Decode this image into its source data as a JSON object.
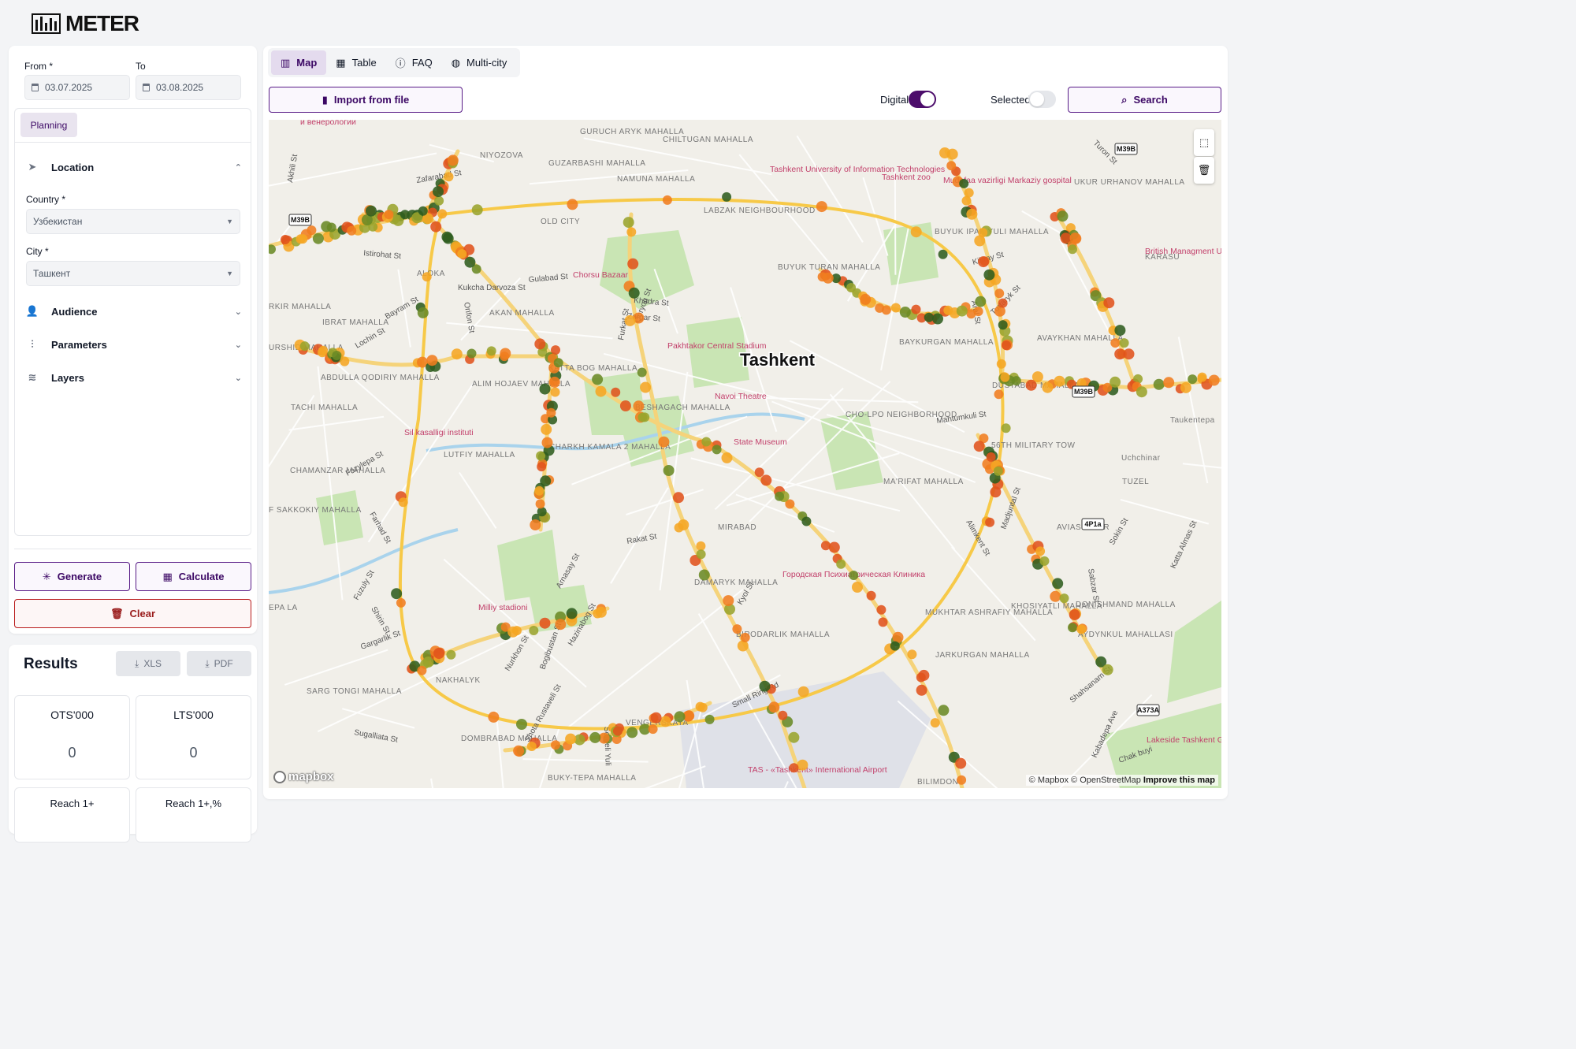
{
  "app": {
    "logo_text": "METER"
  },
  "filters": {
    "from_label": "From *",
    "from_value": "03.07.2025",
    "to_label": "To",
    "to_value": "03.08.2025"
  },
  "planning_tab": "Planning",
  "sections": {
    "location": "Location",
    "country_label": "Country *",
    "country_value": "Узбекистан",
    "city_label": "City *",
    "city_value": "Ташкент",
    "audience": "Audience",
    "parameters": "Parameters",
    "layers": "Layers"
  },
  "actions": {
    "generate": "Generate",
    "calculate": "Calculate",
    "clear": "Clear"
  },
  "results": {
    "title": "Results",
    "xls": "XLS",
    "pdf": "PDF",
    "cards": [
      {
        "label": "OTS'000",
        "value": "0"
      },
      {
        "label": "LTS'000",
        "value": "0"
      },
      {
        "label": "Reach 1+",
        "value": ""
      },
      {
        "label": "Reach 1+,%",
        "value": ""
      }
    ]
  },
  "tabs": [
    {
      "label": "Map",
      "icon": "map-icon",
      "active": true
    },
    {
      "label": "Table",
      "icon": "grid-icon",
      "active": false
    },
    {
      "label": "FAQ",
      "icon": "help-circle-icon",
      "active": false
    },
    {
      "label": "Multi-city",
      "icon": "globe-icon",
      "active": false
    }
  ],
  "toolbar": {
    "import": "Import from file",
    "digital_label": "Digital",
    "digital_on": true,
    "selected_label": "Selected",
    "selected_on": false,
    "search": "Search"
  },
  "map": {
    "city_label": "Tashkent",
    "attribution_mapbox": "© Mapbox",
    "attribution_osm": "© OpenStreetMap",
    "improve": "Improve this map",
    "mapbox_logo": "mapbox",
    "district_labels": [
      "GURUCH ARYK MAHALLA",
      "CHILTUGAN MAHALLA",
      "NIYOZOVA",
      "GUZARBASHI MAHALLA",
      "NAMUNA MAHALLA",
      "OLD CITY",
      "LABZAK NEIGHBOURHOOD",
      "ALOKA",
      "IBRAT MAHALLA",
      "AKAN MAHALLA",
      "BUYUK TURAN MAHALLA",
      "KATTA BOG MAHALLA",
      "ALIM HOJAEV MAHALLA",
      "ABDULLA QODIRIY MAHALLA",
      "TACHI MAHALLA",
      "LUTFIY MAHALLA",
      "CHARKH KAMALA 2 MAHALLA",
      "BESHAGACH MAHALLA",
      "CHAMANZAR MAHALLA",
      "F SAKKOKIY MAHALLA",
      "MIRABAD",
      "DAMARYK MAHALLA",
      "BIRODARLIK MAHALLA",
      "NAKHALYK",
      "SARG TONGI MAHALLA",
      "DOMBRABAD MAHALLA",
      "BUKY-TEPA MAHALLA",
      "VENGERSKAYA",
      "KARASU",
      "BAYKURGAN MAHALLA",
      "DUSTABAD MAHALLA",
      "AVAYKHAN MAHALLA",
      "MA'RIFAT MAHALLA",
      "MUKHTAR ASHRAFIY MAHALLA",
      "JARKURGAN MAHALLA",
      "KHOSIYATLI MAHALLA",
      "AYDYNKUL MAHALLASI",
      "DONISHMAND MAHALLA",
      "AVIASOZLAR",
      "TUZEL",
      "Uchchinar",
      "Taukentepa",
      "56TH MILITARY TOW",
      "BUYUK IPAK YULI MAHALLA",
      "UKUR URHANOV MAHALLA",
      "BILIMDON",
      "CHO-LPO NEIGHBORHOOD",
      "RKIR MAHALLA",
      "URSHID MAHALLA",
      "EPA LA"
    ],
    "poi_labels": [
      "и венерологии",
      "Chorsu Bazaar",
      "Tashkent University of Information Technologies",
      "Tashkent zoo",
      "Mudofaa vazirligi Markaziy gospital",
      "British Managment University",
      "Pakhtakor Central Stadium",
      "Navoi Theatre",
      "State Museum",
      "Sil kasalligi instituti",
      "Milliy stadioni",
      "Городская Психиатрическая Клиника",
      "TAS - «Tashkent» International Airport",
      "Lakeside Tashkent Golf"
    ],
    "street_labels": [
      "Zafarabad St",
      "Istirohat St",
      "Kukcha Darvoza St",
      "Gulabad St",
      "Bayram St",
      "Lochin St",
      "Orifon St",
      "Khadra St",
      "Zargar St",
      "Furkat St",
      "Farhad St",
      "Small Ring Rd",
      "Sugalliata St",
      "Sergeli Yuli",
      "Hazinabog St",
      "Bogibustan St",
      "Nurkhon St",
      "Arnasay St",
      "Rakat St",
      "Kibray St",
      "Aral St",
      "Turtaryk St",
      "Mahtumkuli St",
      "Alimkent St",
      "Madjuntal St",
      "Sabzar St",
      "Shahsanam St",
      "Kabadepa Ave",
      "Katta Almas St",
      "Sokin St",
      "Qoryog St",
      "Fazylepa St",
      "Fuzuly St",
      "Shirin St",
      "Gargarlik St",
      "Akhili St",
      "Turon St",
      "Chak buyi",
      "Kyol St",
      "Shota Rustaveli St"
    ],
    "road_shields": [
      "M39B",
      "M39B",
      "M39B",
      "4P1a",
      "A373A"
    ],
    "point_colors": [
      "#f5a623",
      "#f07d1f",
      "#e0531c",
      "#9aa42c",
      "#6a8a26",
      "#2f5d1f"
    ],
    "marker_count": 460
  },
  "colors": {
    "brand": "#4c0d6b",
    "brand_light": "#e4dbee",
    "danger": "#b91c1c"
  }
}
